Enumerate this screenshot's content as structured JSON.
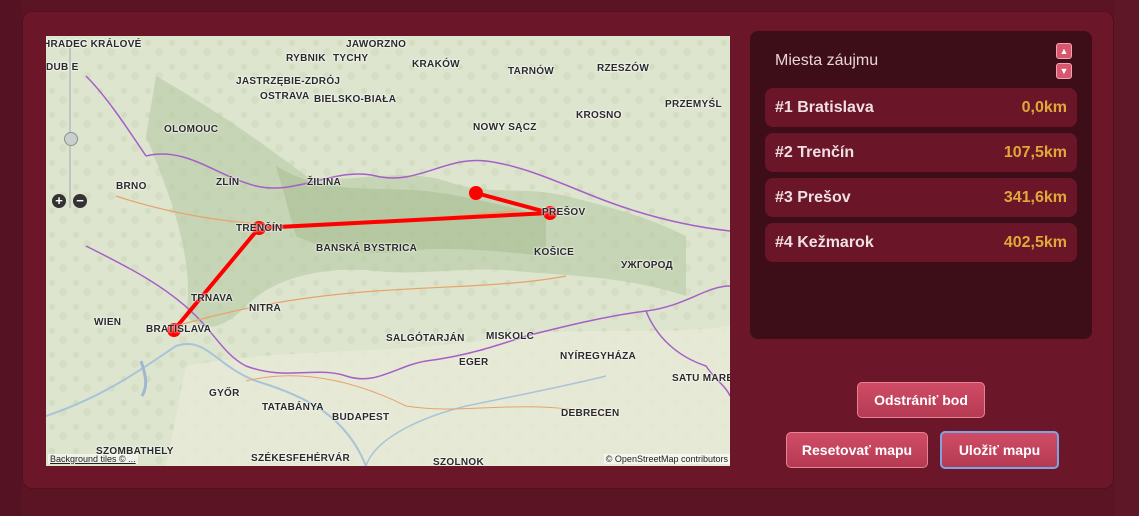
{
  "map": {
    "attribution_left": "Background tiles © ...",
    "attribution_right": "© OpenStreetMap contributors",
    "labels": [
      {
        "name": "HRADEC KRÁLOVÉ"
      },
      {
        "name": "DUBIE"
      },
      {
        "name": "RYBNIK"
      },
      {
        "name": "TYCHY"
      },
      {
        "name": "JAWORZNO"
      },
      {
        "name": "KRAKÓW"
      },
      {
        "name": "TARNÓW"
      },
      {
        "name": "RZESZÓW"
      },
      {
        "name": "JASTRZĘBIE-ZDRÓJ"
      },
      {
        "name": "OSTRAVA"
      },
      {
        "name": "BIELSKO-BIAŁA"
      },
      {
        "name": "PRZEMYŚL"
      },
      {
        "name": "OLOMOUC"
      },
      {
        "name": "NOWY SĄCZ"
      },
      {
        "name": "KROSNO"
      },
      {
        "name": "BRNO"
      },
      {
        "name": "ZLÍN"
      },
      {
        "name": "ŽILINA"
      },
      {
        "name": "PREŠOV"
      },
      {
        "name": "TRENČÍN"
      },
      {
        "name": "BANSKÁ BYSTRICA"
      },
      {
        "name": "KOŠICE"
      },
      {
        "name": "УЖГОРОД"
      },
      {
        "name": "TRNAVA"
      },
      {
        "name": "NITRA"
      },
      {
        "name": "WIEN"
      },
      {
        "name": "BRATISLAVA"
      },
      {
        "name": "SALGÓTARJÁN"
      },
      {
        "name": "MISKOLC"
      },
      {
        "name": "NYÍREGYHÁZA"
      },
      {
        "name": "EGER"
      },
      {
        "name": "SATU MARE"
      },
      {
        "name": "GYŐR"
      },
      {
        "name": "TATABÁNYA"
      },
      {
        "name": "BUDAPEST"
      },
      {
        "name": "DEBRECEN"
      },
      {
        "name": "SZÉKESFEHÉRVÁR"
      },
      {
        "name": "SZOLNOK"
      },
      {
        "name": "SZOMBATHELY"
      }
    ]
  },
  "panel": {
    "title": "Miesta záujmu",
    "up_icon": "▲",
    "down_icon": "▼",
    "items": [
      {
        "label": "#1 Bratislava",
        "distance": "0,0km"
      },
      {
        "label": "#2 Trenčín",
        "distance": "107,5km"
      },
      {
        "label": "#3 Prešov",
        "distance": "341,6km"
      },
      {
        "label": "#4 Kežmarok",
        "distance": "402,5km"
      }
    ]
  },
  "buttons": {
    "remove": "Odstrániť bod",
    "reset": "Resetovať mapu",
    "save": "Uložiť mapu"
  },
  "colors": {
    "route": "#ff0000",
    "accent": "#d04c66",
    "distance": "#e0a83a",
    "panel_bg": "#3e0e18"
  }
}
